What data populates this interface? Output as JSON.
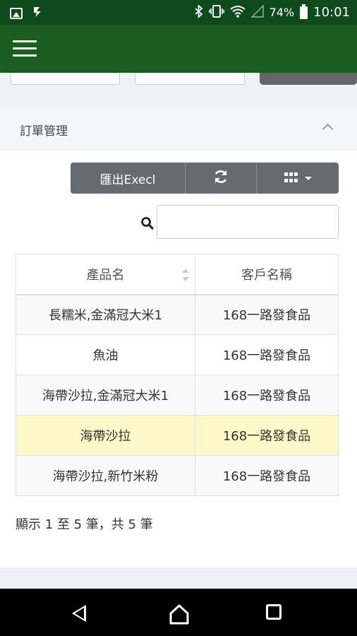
{
  "status_bar": {
    "battery_percent": "74%",
    "time": "10:01",
    "icons": [
      "image-icon",
      "download-icon",
      "bluetooth-icon",
      "vibrate-icon",
      "wifi-icon",
      "signal-icon",
      "battery-icon"
    ]
  },
  "app_bar": {
    "color": "#1b5e20",
    "menu_icon": "hamburger-menu-icon"
  },
  "panel": {
    "title": "訂單管理",
    "collapse_icon": "chevron-up-icon"
  },
  "toolbar": {
    "export_label": "匯出Execl",
    "refresh_icon": "refresh-icon",
    "columns_icon": "grid-columns-icon"
  },
  "search": {
    "icon": "search-icon",
    "value": "",
    "placeholder": ""
  },
  "table": {
    "columns": [
      "產品名",
      "客戶名稱"
    ],
    "rows": [
      {
        "product": "長糯米,金滿冠大米1",
        "customer": "168一路發食品"
      },
      {
        "product": "魚油",
        "customer": "168一路發食品"
      },
      {
        "product": "海帶沙拉,金滿冠大米1",
        "customer": "168一路發食品"
      },
      {
        "product": "海帶沙拉",
        "customer": "168一路發食品"
      },
      {
        "product": "海帶沙拉,新竹米粉",
        "customer": "168一路發食品"
      }
    ]
  },
  "pagination": {
    "info": "顯示 1 至 5 筆，共 5 筆"
  },
  "colors": {
    "status_bar": "#0e4a1c",
    "app_bar": "#1b5e20",
    "toolbar_button": "#666b70",
    "highlight_row": "#fcf8c8"
  }
}
